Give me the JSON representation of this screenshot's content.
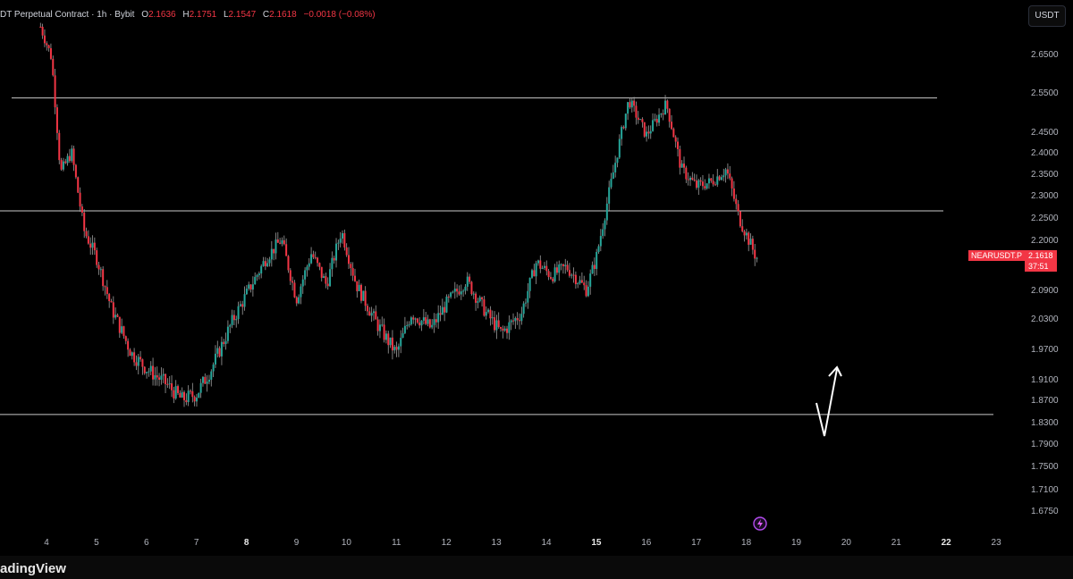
{
  "legend": {
    "symbol": "DT Perpetual Contract · 1h · Bybit",
    "open_label": "O",
    "open": "2.1636",
    "high_label": "H",
    "high": "2.1751",
    "low_label": "L",
    "low": "2.1547",
    "close_label": "C",
    "close": "2.1618",
    "change": "−0.0018 (−0.08%)"
  },
  "toolbar": {
    "currency_label": "USDT"
  },
  "price_badge": {
    "symbol": "NEARUSDT.P",
    "price": "2.1618",
    "countdown": "37:51"
  },
  "footer": {
    "brand": "adingView"
  },
  "icons": {
    "alert": "lightning-icon",
    "annotation": "arrow-drawing"
  },
  "colors": {
    "up": "#26a69a",
    "down": "#f23645",
    "background": "#000000",
    "hline": "#c8c8c8",
    "axis_text": "#b2b5be"
  },
  "chart_data": {
    "type": "candlestick",
    "title": "",
    "x_ticks": [
      "4",
      "5",
      "6",
      "7",
      "8",
      "9",
      "10",
      "11",
      "12",
      "13",
      "14",
      "15",
      "16",
      "17",
      "18",
      "19",
      "20",
      "21",
      "22",
      "23"
    ],
    "bold_x_ticks": [
      "8",
      "15",
      "22"
    ],
    "y_ticks": [
      "2.6500",
      "2.5500",
      "2.4500",
      "2.4000",
      "2.3500",
      "2.3000",
      "2.2500",
      "2.2000",
      "2.0900",
      "2.0300",
      "1.9700",
      "1.9100",
      "1.8700",
      "1.8300",
      "1.7900",
      "1.7500",
      "1.7100",
      "1.6750"
    ],
    "horizontal_levels": [
      2.535,
      2.264,
      1.843
    ],
    "series": [
      {
        "day": 3.88,
        "value": 2.72
      },
      {
        "day": 4.1,
        "value": 2.64
      },
      {
        "day": 4.28,
        "value": 2.35
      },
      {
        "day": 4.5,
        "value": 2.4
      },
      {
        "day": 4.75,
        "value": 2.22
      },
      {
        "day": 5.0,
        "value": 2.16
      },
      {
        "day": 5.3,
        "value": 2.05
      },
      {
        "day": 5.7,
        "value": 1.96
      },
      {
        "day": 6.0,
        "value": 1.93
      },
      {
        "day": 6.4,
        "value": 1.9
      },
      {
        "day": 6.7,
        "value": 1.87
      },
      {
        "day": 7.0,
        "value": 1.88
      },
      {
        "day": 7.3,
        "value": 1.93
      },
      {
        "day": 7.7,
        "value": 2.02
      },
      {
        "day": 8.0,
        "value": 2.08
      },
      {
        "day": 8.4,
        "value": 2.16
      },
      {
        "day": 8.7,
        "value": 2.2
      },
      {
        "day": 9.0,
        "value": 2.07
      },
      {
        "day": 9.3,
        "value": 2.17
      },
      {
        "day": 9.6,
        "value": 2.1
      },
      {
        "day": 9.9,
        "value": 2.22
      },
      {
        "day": 10.2,
        "value": 2.1
      },
      {
        "day": 10.6,
        "value": 2.02
      },
      {
        "day": 11.0,
        "value": 1.96
      },
      {
        "day": 11.3,
        "value": 2.04
      },
      {
        "day": 11.7,
        "value": 2.01
      },
      {
        "day": 12.0,
        "value": 2.06
      },
      {
        "day": 12.4,
        "value": 2.11
      },
      {
        "day": 12.8,
        "value": 2.04
      },
      {
        "day": 13.1,
        "value": 2.0
      },
      {
        "day": 13.5,
        "value": 2.04
      },
      {
        "day": 13.8,
        "value": 2.15
      },
      {
        "day": 14.1,
        "value": 2.12
      },
      {
        "day": 14.4,
        "value": 2.14
      },
      {
        "day": 14.8,
        "value": 2.09
      },
      {
        "day": 15.0,
        "value": 2.16
      },
      {
        "day": 15.3,
        "value": 2.33
      },
      {
        "day": 15.65,
        "value": 2.53
      },
      {
        "day": 16.0,
        "value": 2.44
      },
      {
        "day": 16.4,
        "value": 2.52
      },
      {
        "day": 16.7,
        "value": 2.36
      },
      {
        "day": 17.0,
        "value": 2.32
      },
      {
        "day": 17.3,
        "value": 2.33
      },
      {
        "day": 17.6,
        "value": 2.36
      },
      {
        "day": 17.85,
        "value": 2.25
      },
      {
        "day": 18.2,
        "value": 2.16
      }
    ],
    "last_day": 18.25
  }
}
